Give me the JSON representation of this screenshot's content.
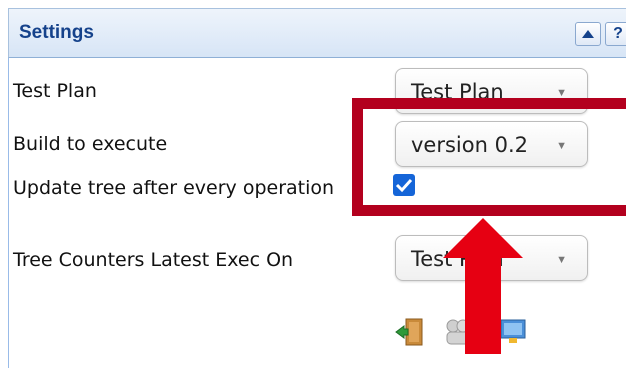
{
  "panel": {
    "title": "Settings",
    "help_label": "?"
  },
  "settings": {
    "test_plan": {
      "label": "Test Plan",
      "value": "Test Plan"
    },
    "build": {
      "label": "Build to execute",
      "value": "version 0.2"
    },
    "update_tree": {
      "label": "Update tree after every operation",
      "checked": true
    },
    "tree_counters": {
      "label": "Tree Counters Latest Exec On",
      "value": "Test Plan"
    }
  },
  "icons": {
    "header_collapse": "triangle-up-icon",
    "header_help": "help-icon",
    "select_arrow": "chevron-down-icon",
    "toolbar": [
      "exit-door-icon",
      "group-icon",
      "monitor-icon"
    ]
  },
  "colors": {
    "header_title": "#15428b",
    "highlight_box": "#b3001e",
    "highlight_arrow": "#e60012",
    "checkbox": "#1565d8"
  }
}
